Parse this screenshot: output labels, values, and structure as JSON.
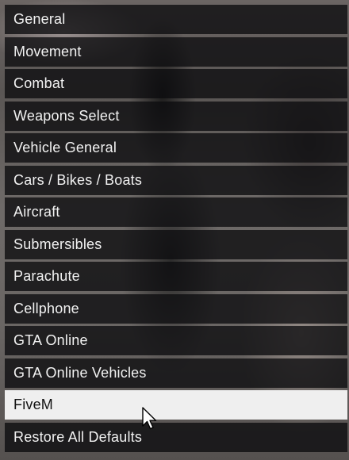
{
  "menu": {
    "items": [
      {
        "label": "General"
      },
      {
        "label": "Movement"
      },
      {
        "label": "Combat"
      },
      {
        "label": "Weapons Select"
      },
      {
        "label": "Vehicle General"
      },
      {
        "label": "Cars / Bikes / Boats"
      },
      {
        "label": "Aircraft"
      },
      {
        "label": "Submersibles"
      },
      {
        "label": "Parachute"
      },
      {
        "label": "Cellphone"
      },
      {
        "label": "GTA Online"
      },
      {
        "label": "GTA Online Vehicles"
      },
      {
        "label": "FiveM",
        "selected": true
      },
      {
        "label": "Restore All Defaults"
      }
    ],
    "colors": {
      "item_bg": "#18181b",
      "item_text": "#f2f2f2",
      "selected_bg": "#efefef",
      "selected_text": "#111111"
    }
  },
  "cursor": {
    "icon": "mouse-pointer-icon"
  }
}
